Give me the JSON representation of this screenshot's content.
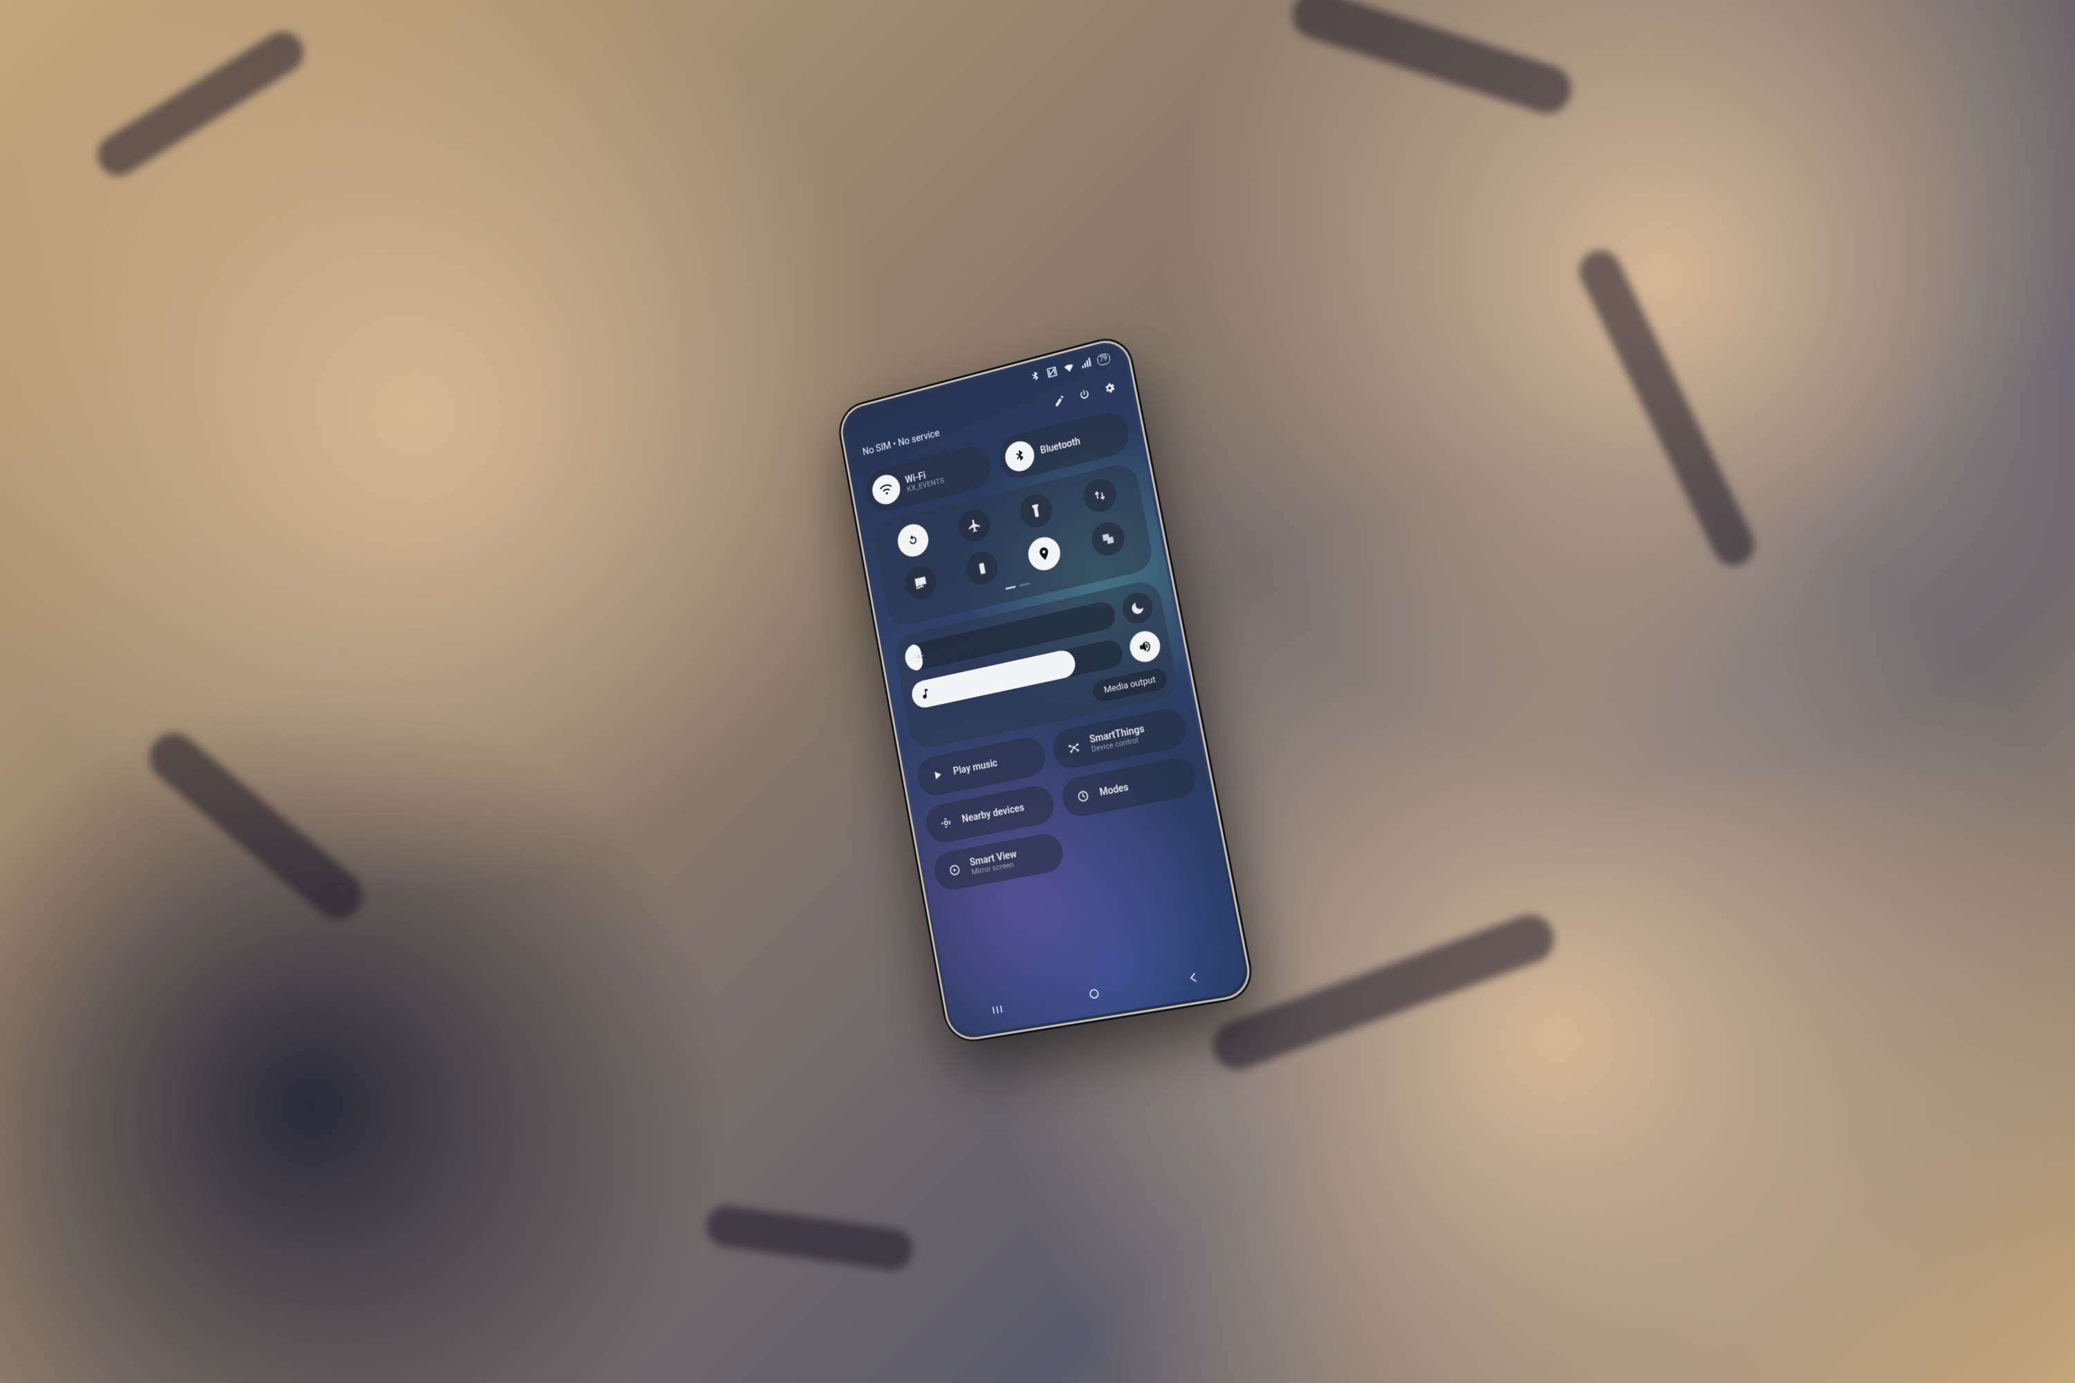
{
  "status": {
    "battery_pct": "79",
    "indicators": [
      "bluetooth",
      "nfc",
      "wifi",
      "signal"
    ]
  },
  "topbar": {
    "carrier_text": "No SIM • No service"
  },
  "quick": {
    "wifi": {
      "label": "Wi-Fi",
      "sub": "KX_EVENTS",
      "on": true
    },
    "bluetooth": {
      "label": "Bluetooth",
      "sub": "",
      "on": true
    }
  },
  "grid_toggles": [
    {
      "name": "auto-rotate",
      "on": true
    },
    {
      "name": "airplane-mode",
      "on": false
    },
    {
      "name": "flashlight",
      "on": false
    },
    {
      "name": "mobile-data",
      "on": false
    },
    {
      "name": "screen-cast",
      "on": false
    },
    {
      "name": "power-saving",
      "on": false
    },
    {
      "name": "location",
      "on": true
    },
    {
      "name": "multi-window",
      "on": false
    }
  ],
  "sliders": {
    "brightness_pct": 8,
    "volume_pct": 78,
    "dnd_on": false,
    "sound_on": true,
    "media_output_label": "Media output"
  },
  "cards": {
    "play_music": {
      "label": "Play music"
    },
    "smartthings": {
      "label": "SmartThings",
      "sub": "Device control"
    },
    "nearby": {
      "label": "Nearby devices"
    },
    "modes": {
      "label": "Modes"
    },
    "smart_view": {
      "label": "Smart View",
      "sub": "Mirror screen"
    }
  }
}
